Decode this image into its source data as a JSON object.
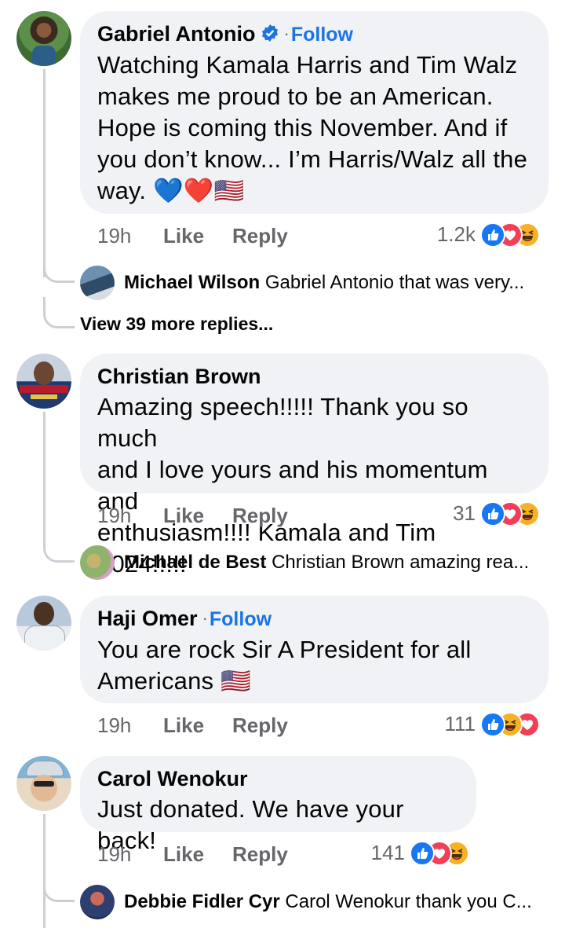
{
  "comments": [
    {
      "author": "Gabriel Antonio",
      "verified": true,
      "follow_label": "Follow",
      "text_lines": [
        "Watching Kamala Harris and Tim Walz",
        "makes me proud to be an American.",
        "Hope is coming this November.  And if",
        "you don’t know... I’m Harris/Walz all the",
        "way. 💙❤️🇺🇸"
      ],
      "time": "19h",
      "like_label": "Like",
      "reply_label": "Reply",
      "reaction_count": "1.2k",
      "reactions": [
        "like-icon",
        "love-icon",
        "haha-icon"
      ],
      "reply_preview": {
        "author": "Michael Wilson",
        "text": "Gabriel Antonio that was very..."
      },
      "more_replies": "View 39 more replies..."
    },
    {
      "author": "Christian Brown",
      "text_lines": [
        "Amazing speech!!!!! Thank you so much",
        "and I love yours and his momentum and",
        "enthusiasm!!!! Kamala and Tim 2024!!!!!"
      ],
      "time": "19h",
      "like_label": "Like",
      "reply_label": "Reply",
      "reaction_count": "31",
      "reactions": [
        "like-icon",
        "love-icon",
        "haha-icon"
      ],
      "reply_preview": {
        "author": "Michael de Best",
        "text": "Christian Brown amazing rea..."
      }
    },
    {
      "author": "Haji Omer",
      "follow_label": "Follow",
      "text_lines": [
        "You are rock Sir A President for all",
        "Americans 🇺🇸"
      ],
      "time": "19h",
      "like_label": "Like",
      "reply_label": "Reply",
      "reaction_count": "111",
      "reactions": [
        "like-icon",
        "haha-icon",
        "love-icon"
      ]
    },
    {
      "author": "Carol Wenokur",
      "text_lines": [
        "Just donated. We have your back!"
      ],
      "time": "19h",
      "like_label": "Like",
      "reply_label": "Reply",
      "reaction_count": "141",
      "reactions": [
        "like-icon",
        "love-icon",
        "haha-icon"
      ],
      "reply_preview": {
        "author": "Debbie Fidler Cyr",
        "text": "Carol Wenokur thank you C..."
      }
    }
  ],
  "colors": {
    "bubble": "#f0f2f5",
    "link_blue": "#1b74e4",
    "meta_gray": "#65676b",
    "thread_line": "#ccd0d5",
    "like": "#1877f2",
    "love": "#f33e58",
    "haha": "#f7b125"
  }
}
